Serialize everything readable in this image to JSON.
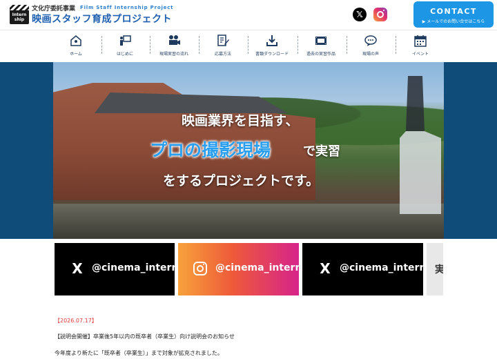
{
  "header": {
    "logo_badge": "Intern ship",
    "logo_sub": "文化庁委託事業",
    "logo_sub_en": "Film Staff Internship Project",
    "logo_title": "映画スタッフ育成プロジェクト",
    "sns": {
      "x_label": "𝕏"
    },
    "contact": {
      "label": "CONTACT",
      "sub": "▶ メールでのお問い合せはこちら"
    }
  },
  "nav": {
    "items": [
      {
        "label": "ホーム",
        "icon": "home-icon"
      },
      {
        "label": "はじめに",
        "icon": "presenter-icon"
      },
      {
        "label": "現場実習の流れ",
        "icon": "movie-camera-icon"
      },
      {
        "label": "応募方法",
        "icon": "edit-document-icon"
      },
      {
        "label": "書類ダウンロード",
        "icon": "download-icon"
      },
      {
        "label": "過去の実習作品",
        "icon": "film-icon"
      },
      {
        "label": "現場の声",
        "icon": "speech-bubble-icon"
      },
      {
        "label": "イベント",
        "icon": "calendar-icon"
      }
    ]
  },
  "hero": {
    "line1": "映画業界を目指す、",
    "line2": "プロの撮影現場",
    "line2b": "で実習",
    "line3": "をするプロジェクトです。"
  },
  "banners": {
    "x1": "@cinema_intern",
    "ig": "@cinema_intern",
    "x2": "@cinema_intern",
    "peek": "実"
  },
  "news": {
    "date": "【2026.07.17】",
    "title": "【説明会開催】卒業後5年以内の既卒者（卒業生）向け説明会のお知らせ",
    "body": "今年度より新たに「既卒者（卒業生）」まで対象が拡充されました。"
  },
  "colors": {
    "brand_blue": "#1f5fb0",
    "contact_blue": "#1d96e6",
    "hero_bg": "#0f4c7a",
    "date_red": "#e23b3b"
  }
}
